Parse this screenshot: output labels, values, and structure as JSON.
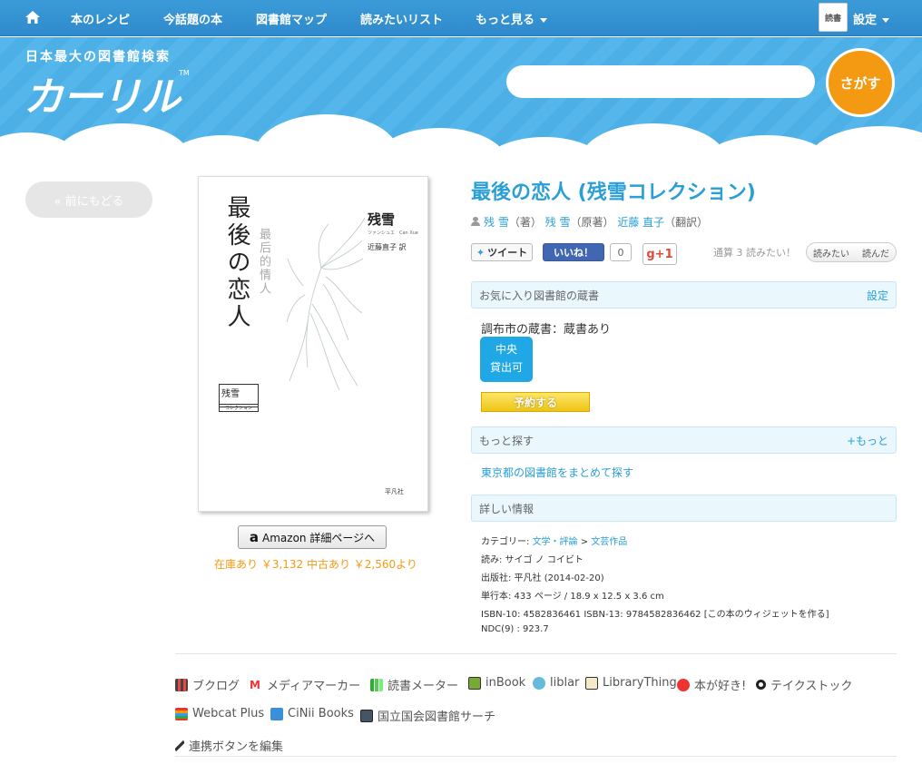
{
  "nav": {
    "items": [
      "本のレシピ",
      "今話題の本",
      "図書館マップ",
      "読みたいリスト",
      "もっと見る"
    ],
    "settings_label": "設定",
    "avatar_text": "読書"
  },
  "hero": {
    "tagline": "日本最大の図書館検索",
    "logo": "カーリル",
    "tm": "TM",
    "search_placeholder": "",
    "search_button": "さがす"
  },
  "back_label": "« 前にもどる",
  "cover": {
    "title": "最後の恋人",
    "subtitle": "最后的情人",
    "author": "残雪",
    "author_roman": "ツァンシュエ　Can Xue",
    "translator": "近藤直子 訳",
    "series": "残雪",
    "series_sub": "コレクション",
    "publisher": "平凡社"
  },
  "amazon": {
    "logo": "a",
    "label": "Amazon 詳細ページへ",
    "stock": "在庫あり ￥3,132 中古あり ￥2,560より"
  },
  "book": {
    "title": "最後の恋人 (残雪コレクション)",
    "authors": [
      {
        "name": "残 雪",
        "role": "（著）"
      },
      {
        "name": "残 雪",
        "role": "（原著）"
      },
      {
        "name": "近藤 直子",
        "role": "（翻訳）"
      }
    ]
  },
  "social": {
    "tweet": "ツイート",
    "like": "いいね！",
    "like_count": "0",
    "gplus": "g+1",
    "count_text": "通算 3 読みたい！",
    "want": "読みたい",
    "read": "読んだ"
  },
  "fav": {
    "heading": "お気に入り図書館の蔵書",
    "settings": "設定",
    "holding": "調布市の蔵書：蔵書あり",
    "branch": "中央",
    "status": "貸出可",
    "reserve": "予約する"
  },
  "more": {
    "heading": "もっと探す",
    "more_link": "+もっと",
    "tokyo": "東京都の図書館をまとめて探す"
  },
  "details": {
    "heading": "詳しい情報",
    "category_label": "カテゴリー: ",
    "category_1": "文学・評論",
    "category_sep": " > ",
    "category_2": "文芸作品",
    "reading": "読み: サイゴ ノ コイビト",
    "publisher": "出版社: 平凡社 (2014-02-20)",
    "format": "単行本: 433 ページ / 18.9 x 12.5 x 3.6 cm",
    "isbn": "ISBN-10: 4582836461  ISBN-13: 9784582836462  [この本のウィジェットを作る]",
    "ndc": "NDC(9) : 923.7"
  },
  "services": {
    "row1": [
      "ブクログ",
      "メディアマーカー",
      "読書メーター",
      "inBook",
      "liblar",
      "LibraryThing",
      "本が好き!",
      "テイクストック"
    ],
    "row2": [
      "Webcat Plus",
      "CiNii Books",
      "国立国会図書館サーチ"
    ],
    "edit": "連携ボタンを編集"
  }
}
